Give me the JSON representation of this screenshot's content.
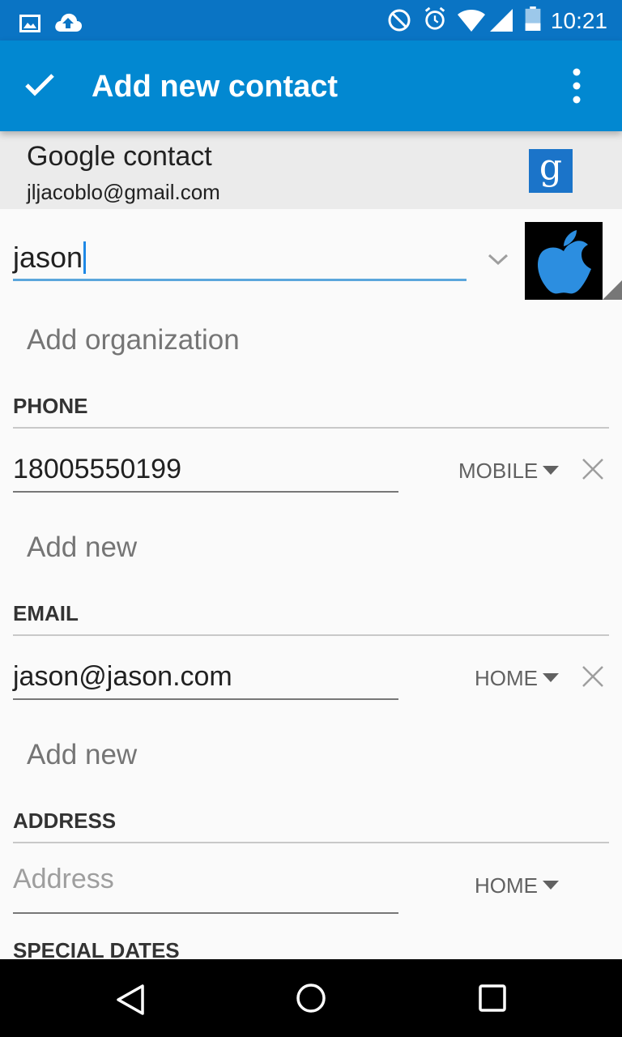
{
  "status_bar": {
    "time": "10:21",
    "icons": [
      "gallery-icon",
      "cloud-upload-icon",
      "do-not-disturb-icon",
      "alarm-icon",
      "wifi-icon",
      "signal-icon",
      "battery-icon"
    ]
  },
  "toolbar": {
    "title": "Add new contact",
    "save_icon": "check-icon",
    "menu_icon": "overflow-menu-icon"
  },
  "account": {
    "type": "Google contact",
    "email": "jljacoblo@gmail.com",
    "logo_letter": "g"
  },
  "name": {
    "value": "jason",
    "photo_icon": "apple-logo-icon"
  },
  "organization": {
    "placeholder": "Add organization"
  },
  "phone": {
    "title": "PHONE",
    "value": "18005550199",
    "type": "MOBILE",
    "add_new": "Add new"
  },
  "email": {
    "title": "EMAIL",
    "value": "jason@jason.com",
    "type": "HOME",
    "add_new": "Add new"
  },
  "address": {
    "title": "ADDRESS",
    "placeholder": "Address",
    "type": "HOME"
  },
  "special_dates": {
    "title": "SPECIAL DATES"
  },
  "nav": {
    "icons": [
      "back-icon",
      "home-icon",
      "recents-icon"
    ]
  },
  "colors": {
    "status_bar": "#0a74c4",
    "toolbar": "#0288d1",
    "accent": "#5aa6dc"
  }
}
